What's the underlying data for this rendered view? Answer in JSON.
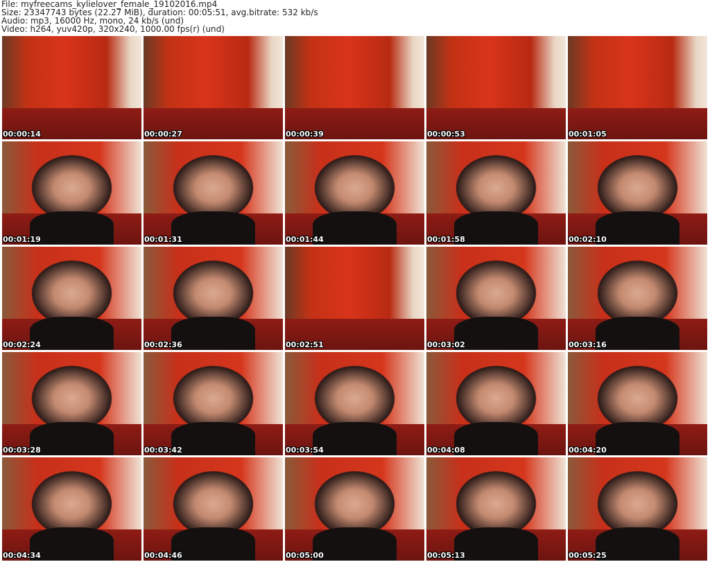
{
  "header": {
    "file": "File: myfreecams_kylielover_female_19102016.mp4",
    "size": "Size: 23347743 bytes (22.27 MiB), duration: 00:05:51, avg.bitrate: 532 kb/s",
    "audio": "Audio: mp3, 16000 Hz, mono, 24 kb/s (und)",
    "video": "Video: h264, yuv420p, 320x240, 1000.00 fps(r) (und)"
  },
  "thumbnails": [
    {
      "time": "00:00:14",
      "shot": "wide"
    },
    {
      "time": "00:00:27",
      "shot": "wide"
    },
    {
      "time": "00:00:39",
      "shot": "wide"
    },
    {
      "time": "00:00:53",
      "shot": "wide"
    },
    {
      "time": "00:01:05",
      "shot": "wide"
    },
    {
      "time": "00:01:19",
      "shot": "close"
    },
    {
      "time": "00:01:31",
      "shot": "close"
    },
    {
      "time": "00:01:44",
      "shot": "close"
    },
    {
      "time": "00:01:58",
      "shot": "close"
    },
    {
      "time": "00:02:10",
      "shot": "close"
    },
    {
      "time": "00:02:24",
      "shot": "close"
    },
    {
      "time": "00:02:36",
      "shot": "close"
    },
    {
      "time": "00:02:51",
      "shot": "wide"
    },
    {
      "time": "00:03:02",
      "shot": "close"
    },
    {
      "time": "00:03:16",
      "shot": "close"
    },
    {
      "time": "00:03:28",
      "shot": "close"
    },
    {
      "time": "00:03:42",
      "shot": "close"
    },
    {
      "time": "00:03:54",
      "shot": "close"
    },
    {
      "time": "00:04:08",
      "shot": "close"
    },
    {
      "time": "00:04:20",
      "shot": "close"
    },
    {
      "time": "00:04:34",
      "shot": "close"
    },
    {
      "time": "00:04:46",
      "shot": "close"
    },
    {
      "time": "00:05:00",
      "shot": "close"
    },
    {
      "time": "00:05:13",
      "shot": "close"
    },
    {
      "time": "00:05:25",
      "shot": "close"
    }
  ]
}
